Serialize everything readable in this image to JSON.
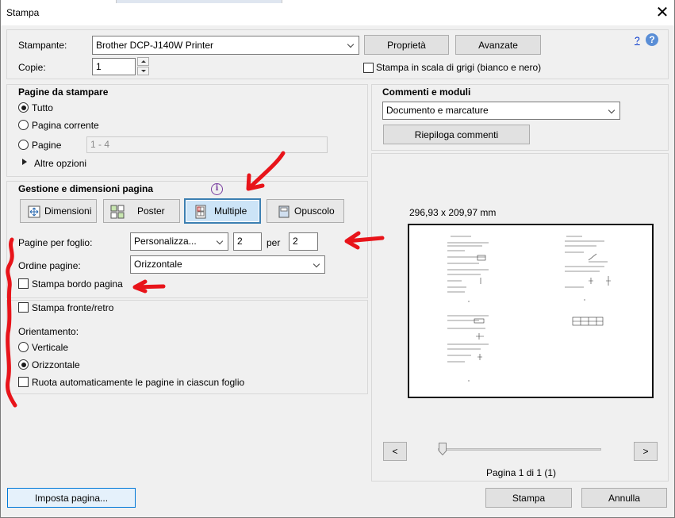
{
  "window": {
    "title": "Stampa"
  },
  "printer": {
    "label": "Stampante:",
    "selected": "Brother DCP-J140W Printer",
    "properties_label": "Proprietà",
    "advanced_label": "Avanzate",
    "help_link": "?"
  },
  "copies": {
    "label": "Copie:",
    "value": "1"
  },
  "grayscale": {
    "label": "Stampa in scala di grigi (bianco e nero)",
    "checked": false
  },
  "pages_to_print": {
    "title": "Pagine da stampare",
    "all_label": "Tutto",
    "current_label": "Pagina corrente",
    "pages_label": "Pagine",
    "pages_placeholder": "1 - 4",
    "selected": "all",
    "more_options_label": "Altre opzioni"
  },
  "page_handling": {
    "title": "Gestione e dimensioni pagina",
    "modes": [
      {
        "label": "Dimensioni",
        "icon": "resize-page-icon"
      },
      {
        "label": "Poster",
        "icon": "poster-grid-icon"
      },
      {
        "label": "Multiple",
        "icon": "multiple-pages-icon"
      },
      {
        "label": "Opuscolo",
        "icon": "booklet-icon"
      }
    ],
    "active_mode": "Multiple"
  },
  "multiple": {
    "pages_per_sheet_label": "Pagine per foglio:",
    "pages_per_sheet_value": "Personalizza...",
    "cols": "2",
    "by_label": "per",
    "rows": "2",
    "order_label": "Ordine pagine:",
    "order_value": "Orizzontale",
    "border_label": "Stampa bordo pagina",
    "border_checked": false
  },
  "duplex": {
    "label": "Stampa fronte/retro",
    "checked": false
  },
  "orientation": {
    "label": "Orientamento:",
    "portrait_label": "Verticale",
    "landscape_label": "Orizzontale",
    "selected": "landscape",
    "auto_rotate_label": "Ruota automaticamente le pagine in ciascun foglio",
    "auto_rotate_checked": false
  },
  "comments": {
    "title": "Commenti e moduli",
    "selected": "Documento e marcature",
    "summarize_label": "Riepiloga commenti"
  },
  "preview": {
    "size_text": "296,93 x 209,97 mm",
    "page_info": "Pagina 1 di 1 (1)",
    "prev_label": "<",
    "next_label": ">"
  },
  "footer": {
    "page_setup_label": "Imposta pagina...",
    "print_label": "Stampa",
    "cancel_label": "Annulla"
  },
  "colors": {
    "annotation_red": "#e8141a",
    "active_button_bg": "#cce4f7",
    "active_button_border": "#3c7fb1"
  }
}
